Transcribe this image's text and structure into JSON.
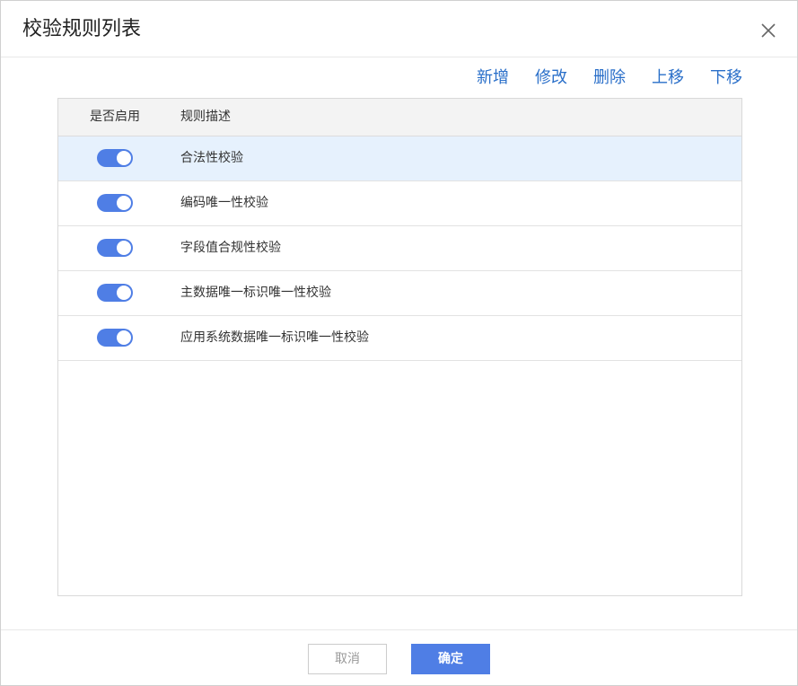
{
  "dialog": {
    "title": "校验规则列表"
  },
  "toolbar": {
    "add_label": "新增",
    "edit_label": "修改",
    "delete_label": "删除",
    "move_up_label": "上移",
    "move_down_label": "下移"
  },
  "table": {
    "columns": [
      "是否启用",
      "规则描述"
    ],
    "rows": [
      {
        "enabled": true,
        "description": "合法性校验",
        "selected": true
      },
      {
        "enabled": true,
        "description": "编码唯一性校验",
        "selected": false
      },
      {
        "enabled": true,
        "description": "字段值合规性校验",
        "selected": false
      },
      {
        "enabled": true,
        "description": "主数据唯一标识唯一性校验",
        "selected": false
      },
      {
        "enabled": true,
        "description": "应用系统数据唯一标识唯一性校验",
        "selected": false
      }
    ]
  },
  "footer": {
    "cancel_label": "取消",
    "ok_label": "确定"
  },
  "colors": {
    "accent": "#4f7ee5",
    "link": "#2a6fc9",
    "selected_row": "#e6f1fd"
  },
  "icons": {
    "close": "close-icon"
  }
}
